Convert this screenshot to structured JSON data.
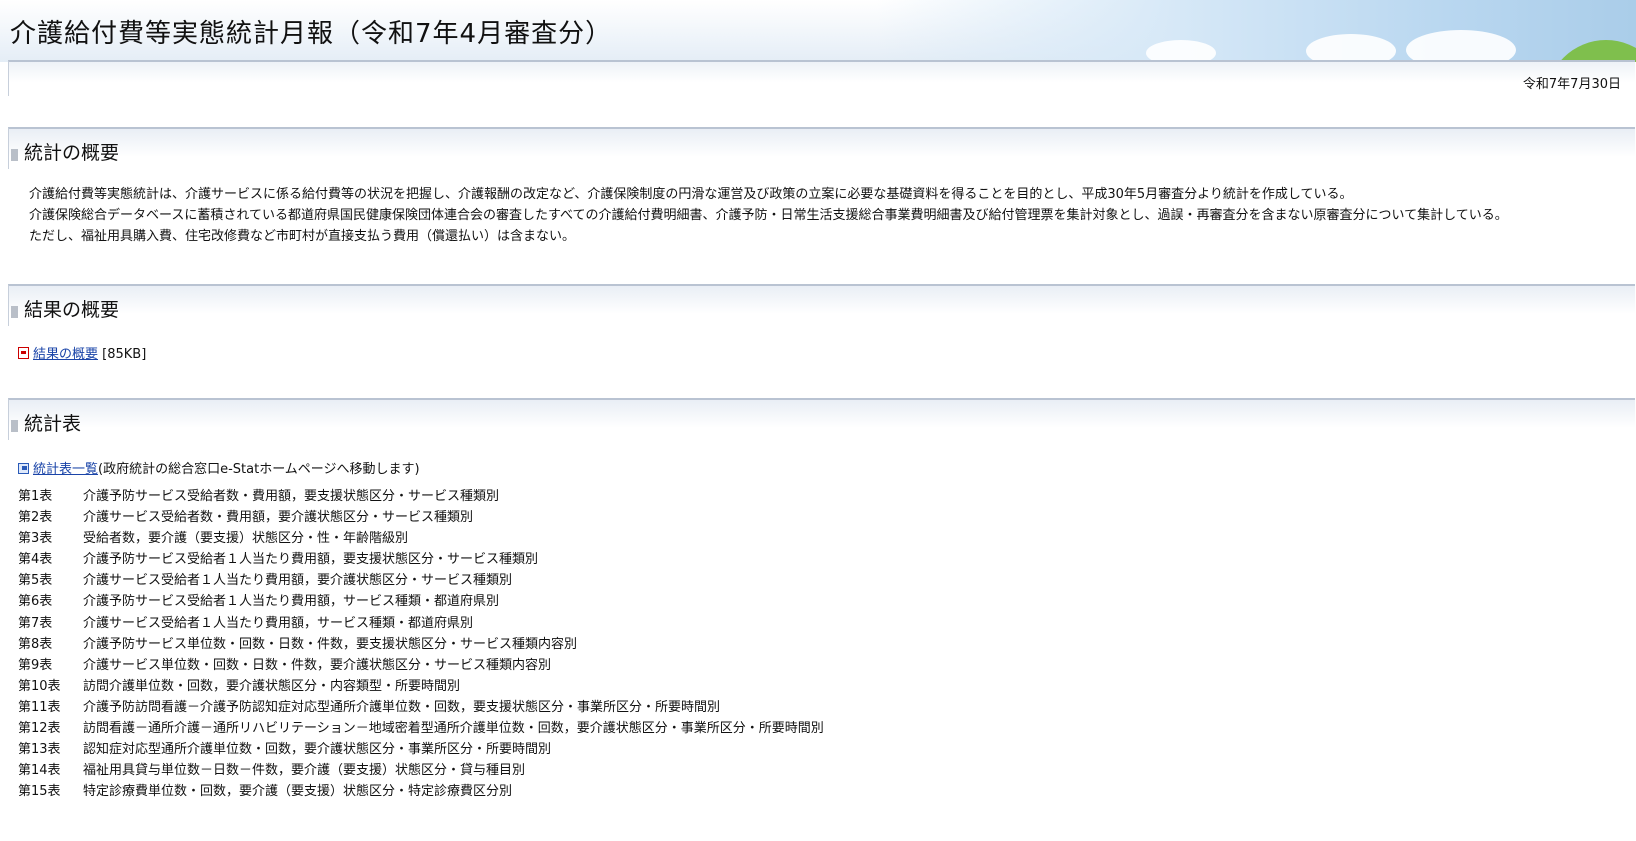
{
  "header": {
    "title": "介護給付費等実態統計月報（令和7年4月審査分）"
  },
  "date": "令和7年7月30日",
  "sections": {
    "overview": {
      "heading": "統計の概要",
      "paragraphs": [
        "介護給付費等実態統計は、介護サービスに係る給付費等の状況を把握し、介護報酬の改定など、介護保険制度の円滑な運営及び政策の立案に必要な基礎資料を得ることを目的とし、平成30年5月審査分より統計を作成している。",
        "介護保険総合データベースに蓄積されている都道府県国民健康保険団体連合会の審査したすべての介護給付費明細書、介護予防・日常生活支援総合事業費明細書及び給付管理票を集計対象とし、過誤・再審査分を含まない原審査分について集計している。",
        "ただし、福祉用具購入費、住宅改修費など市町村が直接支払う費用（償還払い）は含まない。"
      ]
    },
    "results": {
      "heading": "結果の概要",
      "link_label": "結果の概要",
      "file_size": "[85KB]",
      "link_icon": "pdf-icon"
    },
    "tables": {
      "heading": "統計表",
      "estat_link_label": "統計表一覧",
      "estat_note": "(政府統計の総合窓口e-Statホームページへ移動します)",
      "estat_icon": "external-link-icon",
      "items": [
        {
          "num": "第1表",
          "title": "介護予防サービス受給者数・費用額，要支援状態区分・サービス種類別"
        },
        {
          "num": "第2表",
          "title": "介護サービス受給者数・費用額，要介護状態区分・サービス種類別"
        },
        {
          "num": "第3表",
          "title": "受給者数，要介護（要支援）状態区分・性・年齢階級別"
        },
        {
          "num": "第4表",
          "title": "介護予防サービス受給者１人当たり費用額，要支援状態区分・サービス種類別"
        },
        {
          "num": "第5表",
          "title": "介護サービス受給者１人当たり費用額，要介護状態区分・サービス種類別"
        },
        {
          "num": "第6表",
          "title": "介護予防サービス受給者１人当たり費用額，サービス種類・都道府県別"
        },
        {
          "num": "第7表",
          "title": "介護サービス受給者１人当たり費用額，サービス種類・都道府県別"
        },
        {
          "num": "第8表",
          "title": "介護予防サービス単位数・回数・日数・件数，要支援状態区分・サービス種類内容別"
        },
        {
          "num": "第9表",
          "title": "介護サービス単位数・回数・日数・件数，要介護状態区分・サービス種類内容別"
        },
        {
          "num": "第10表",
          "title": "訪問介護単位数・回数，要介護状態区分・内容類型・所要時間別"
        },
        {
          "num": "第11表",
          "title": "介護予防訪問看護－介護予防認知症対応型通所介護単位数・回数，要支援状態区分・事業所区分・所要時間別"
        },
        {
          "num": "第12表",
          "title": "訪問看護－通所介護－通所リハビリテーション－地域密着型通所介護単位数・回数，要介護状態区分・事業所区分・所要時間別"
        },
        {
          "num": "第13表",
          "title": "認知症対応型通所介護単位数・回数，要介護状態区分・事業所区分・所要時間別"
        },
        {
          "num": "第14表",
          "title": "福祉用具貸与単位数－日数－件数，要介護（要支援）状態区分・貸与種目別"
        },
        {
          "num": "第15表",
          "title": "特定診療費単位数・回数，要介護（要支援）状態区分・特定診療費区分別"
        }
      ]
    }
  }
}
